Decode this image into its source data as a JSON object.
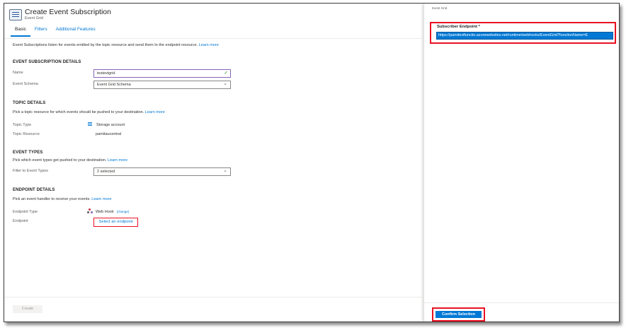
{
  "header": {
    "title": "Create Event Subscription",
    "subtitle": "Event Grid"
  },
  "tabs": [
    {
      "label": "Basic"
    },
    {
      "label": "Filters"
    },
    {
      "label": "Additional Features"
    }
  ],
  "intro": {
    "text": "Event Subscriptions listen for events emitted by the topic resource and send them to the endpoint resource.",
    "link": "Learn more"
  },
  "subscription_details": {
    "heading": "EVENT SUBSCRIPTION DETAILS",
    "name_label": "Name",
    "name_value": "testevtgrid",
    "schema_label": "Event Schema",
    "schema_value": "Event Grid Schema"
  },
  "topic_details": {
    "heading": "TOPIC DETAILS",
    "desc": "Pick a topic resource for which events should be pushed to your destination.",
    "link": "Learn more",
    "type_label": "Topic Type",
    "type_value": "Storage account",
    "resource_label": "Topic Resource",
    "resource_value": "pamitaucentral"
  },
  "event_types": {
    "heading": "EVENT TYPES",
    "desc": "Pick which event types get pushed to your destination.",
    "link": "Learn more",
    "filter_label": "Filter to Event Types",
    "filter_value": "2 selected"
  },
  "endpoint_details": {
    "heading": "ENDPOINT DETAILS",
    "desc": "Pick an event handler to receive your events.",
    "link": "Learn more",
    "type_label": "Endpoint Type",
    "type_value": "Web Hook",
    "change_link": "(change)",
    "endpoint_label": "Endpoint",
    "endpoint_link": "Select an endpoint"
  },
  "footer": {
    "create_label": "Create"
  },
  "right_panel": {
    "caption": "Event Grid",
    "subscriber_label": "Subscriber Endpoint *",
    "subscriber_value": "https://pamitevtfunctio.azurewebsites.net/runtime/webhooks/EventGrid?functionName=E",
    "confirm_label": "Confirm Selection"
  },
  "colors": {
    "accent": "#0078d4",
    "highlight": "#e81123",
    "success": "#107c10"
  }
}
